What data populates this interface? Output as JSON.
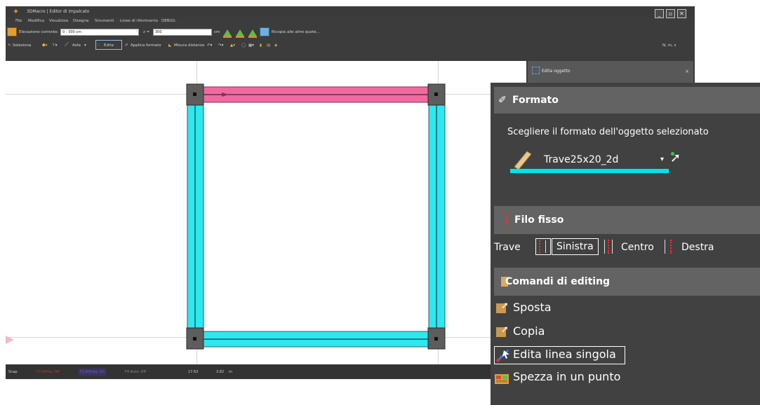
{
  "window": {
    "title": "3DMacro | Editor di impalcato",
    "controls": [
      "_",
      "▫",
      "✕"
    ]
  },
  "menu": [
    "File",
    "Modifica",
    "Visualizza",
    "Disegna",
    "Strumenti",
    "Linee di riferimento",
    "DEBUG"
  ],
  "toolbar1": {
    "elevation_label": "Elevazione corrente:",
    "elevation_value": "0 - 300 cm",
    "z_label": "z =",
    "z_value": "300",
    "unit": "cm",
    "copy_label": "Ricopia alle altre quote..."
  },
  "toolbar2": {
    "select_label": "Seleziona",
    "aste_label": "Aste",
    "edita_label": "Edita",
    "apply_format_label": "Applica formato",
    "measure_label": "Misura distanza",
    "units_label": "N, m, s"
  },
  "panel_header": {
    "title": "Edita oggetto",
    "close": "×"
  },
  "statusbar": {
    "items": [
      "Snap",
      "F2 Ortho: Off",
      "F3 Allinea: On",
      "F4 Auto: Off"
    ],
    "coord_x": "17.63",
    "coord_y": "3.82",
    "unit": "m"
  },
  "props": {
    "formato": {
      "title": "Formato",
      "instruction": "Scegliere il formato dell'oggetto selezionato",
      "selected": "Trave25x20_2d",
      "swatch_color": "#00e4f0"
    },
    "filo_fisso": {
      "title": "Filo fisso",
      "row_label": "Trave",
      "options": [
        "Sinistra",
        "Centro",
        "Destra"
      ],
      "selected": "Sinistra"
    },
    "comandi": {
      "title": "Comandi di editing",
      "items": [
        "Sposta",
        "Copia",
        "Edita linea singola",
        "Spezza in un punto"
      ],
      "active": "Edita linea singola"
    }
  },
  "colors": {
    "beam_cyan": "#2ee8f0",
    "beam_pink": "#f06aa0",
    "column": "#5d5d5d",
    "panel_bg": "#414141",
    "section_head": "#636363"
  }
}
